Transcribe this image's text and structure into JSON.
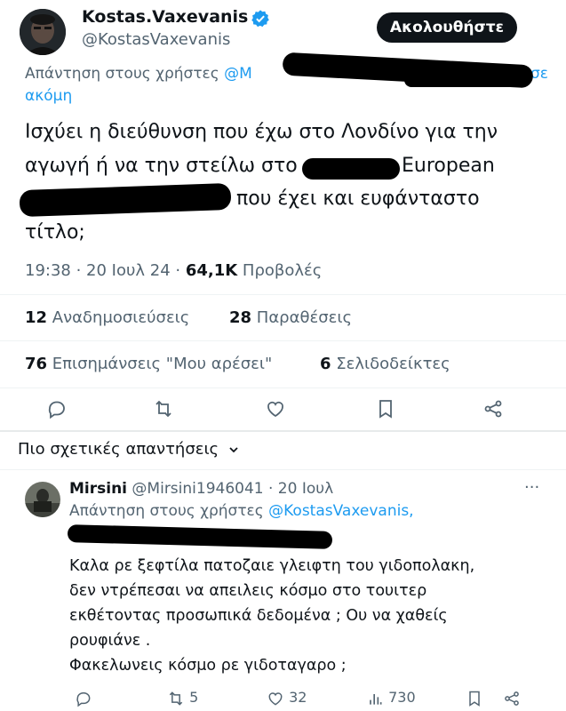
{
  "author": {
    "name": "Kostas.Vaxevanis",
    "handle": "@KostasVaxevanis",
    "follow_label": "Ακολουθήστε"
  },
  "tweet": {
    "reply_prefix": "Απάντηση στους χρήστες",
    "reply_mention": "@M",
    "reply_tail1": "σε",
    "reply_tail2": "ακόμη",
    "text_line1": "Ισχύει η διεύθυνση που έχω στο Λονδίνο για την",
    "text_line2a": "αγωγή ή να την στείλω στο",
    "text_line2b": "European",
    "text_line3": "που έχει και ευφάνταστο",
    "text_line4": "τίτλο;",
    "time": "19:38 · 20 Ιουλ 24 · ",
    "views_count": "64,1K",
    "views_label": " Προβολές"
  },
  "stats": {
    "reposts_count": "12",
    "reposts_label": " Αναδημοσιεύσεις",
    "quotes_count": "28",
    "quotes_label": " Παραθέσεις",
    "likes_count": "76",
    "likes_label": " Επισημάνσεις \"Μου αρέσει\"",
    "bookmarks_count": "6",
    "bookmarks_label": " Σελιδοδείκτες"
  },
  "replies_header": "Πιο σχετικές απαντήσεις",
  "reply": {
    "name": "Mirsini",
    "handle": "@Mirsini1946041",
    "date": "· 20 Ιουλ",
    "more": "···",
    "reply_prefix": "Απάντηση στους χρήστες",
    "reply_mention": "@KostasVaxevanis,",
    "line1": "Καλα ρε ξεφτίλα πατοζαιε γλειφτη του γιδοπολακη,",
    "line2": "δεν ντρέπεσαι να απειλεις κόσμο στο τουιτερ",
    "line3": "εκθέτοντας προσωπικά δεδομένα ; Ου να χαθείς",
    "line4": "ρουφιάνε .",
    "line5": "Φακελωνεις κόσμο ρε γιδοταγαρο ;",
    "reposts": "5",
    "likes": "32",
    "views": "730"
  },
  "colors": {
    "accent": "#1d9bf0",
    "text": "#0f1419",
    "muted": "#536471",
    "verified": "#1d9bf0"
  }
}
